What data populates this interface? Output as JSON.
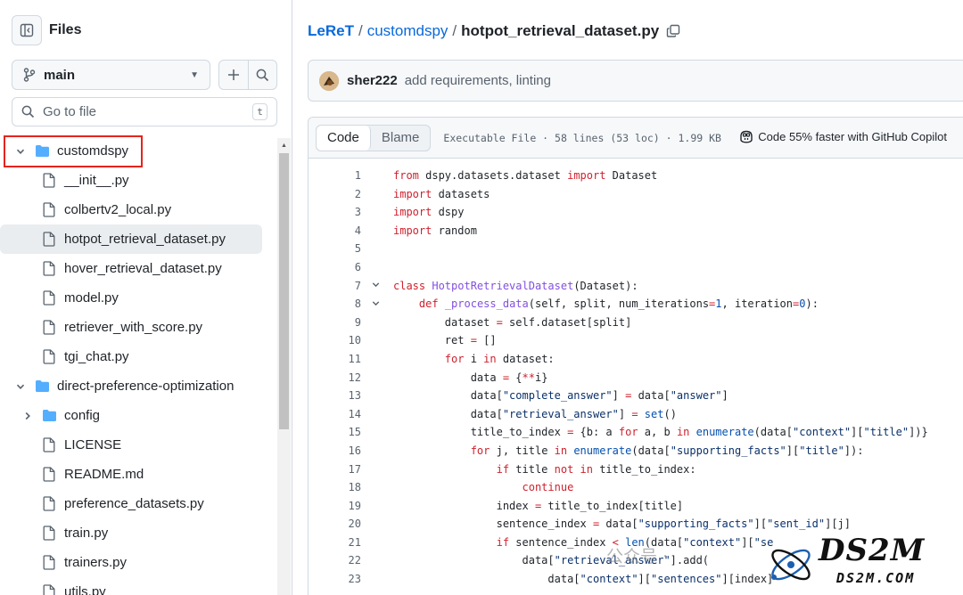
{
  "sidebar": {
    "title": "Files",
    "branch": "main",
    "search_placeholder": "Go to file",
    "search_shortcut": "t",
    "tree": [
      {
        "name": "customdspy",
        "type": "folder",
        "depth": 0,
        "expanded": true,
        "highlighted": true
      },
      {
        "name": "__init__.py",
        "type": "file",
        "depth": 1
      },
      {
        "name": "colbertv2_local.py",
        "type": "file",
        "depth": 1
      },
      {
        "name": "hotpot_retrieval_dataset.py",
        "type": "file",
        "depth": 1,
        "active": true
      },
      {
        "name": "hover_retrieval_dataset.py",
        "type": "file",
        "depth": 1
      },
      {
        "name": "model.py",
        "type": "file",
        "depth": 1
      },
      {
        "name": "retriever_with_score.py",
        "type": "file",
        "depth": 1
      },
      {
        "name": "tgi_chat.py",
        "type": "file",
        "depth": 1
      },
      {
        "name": "direct-preference-optimization",
        "type": "folder",
        "depth": 0,
        "expanded": true
      },
      {
        "name": "config",
        "type": "folder",
        "depth": 1,
        "expanded": false
      },
      {
        "name": "LICENSE",
        "type": "file",
        "depth": 1
      },
      {
        "name": "README.md",
        "type": "file",
        "depth": 1
      },
      {
        "name": "preference_datasets.py",
        "type": "file",
        "depth": 1
      },
      {
        "name": "train.py",
        "type": "file",
        "depth": 1
      },
      {
        "name": "trainers.py",
        "type": "file",
        "depth": 1
      },
      {
        "name": "utils.py",
        "type": "file",
        "depth": 1
      }
    ]
  },
  "breadcrumb": {
    "repo": "LeReT",
    "folder": "customdspy",
    "file": "hotpot_retrieval_dataset.py"
  },
  "commit": {
    "author": "sher222",
    "message": "add requirements, linting"
  },
  "file_header": {
    "tab_code": "Code",
    "tab_blame": "Blame",
    "meta": "Executable File · 58 lines (53 loc) · 1.99 KB",
    "copilot": "Code 55% faster with GitHub Copilot"
  },
  "code_lines": [
    {
      "n": "1",
      "fold": "",
      "html": "<span class=\"k\">from</span> dspy.datasets.dataset <span class=\"k\">import</span> Dataset"
    },
    {
      "n": "2",
      "fold": "",
      "html": "<span class=\"k\">import</span> datasets"
    },
    {
      "n": "3",
      "fold": "",
      "html": "<span class=\"k\">import</span> dspy"
    },
    {
      "n": "4",
      "fold": "",
      "html": "<span class=\"k\">import</span> random"
    },
    {
      "n": "5",
      "fold": "",
      "html": ""
    },
    {
      "n": "6",
      "fold": "",
      "html": ""
    },
    {
      "n": "7",
      "fold": "v",
      "html": "<span class=\"k\">class</span> <span class=\"f\">HotpotRetrievalDataset</span>(Dataset):"
    },
    {
      "n": "8",
      "fold": "v",
      "html": "    <span class=\"k\">def</span> <span class=\"f\">_process_data</span>(self, split, num_iterations<span class=\"k\">=</span><span class=\"n\">1</span>, iteration<span class=\"k\">=</span><span class=\"n\">0</span>):"
    },
    {
      "n": "9",
      "fold": "",
      "html": "        dataset <span class=\"k\">=</span> self.dataset[split]"
    },
    {
      "n": "10",
      "fold": "",
      "html": "        ret <span class=\"k\">=</span> []"
    },
    {
      "n": "11",
      "fold": "",
      "html": "        <span class=\"k\">for</span> i <span class=\"k\">in</span> dataset:"
    },
    {
      "n": "12",
      "fold": "",
      "html": "            data <span class=\"k\">=</span> {<span class=\"k\">**</span>i}"
    },
    {
      "n": "13",
      "fold": "",
      "html": "            data[<span class=\"s\">\"complete_answer\"</span>] <span class=\"k\">=</span> data[<span class=\"s\">\"answer\"</span>]"
    },
    {
      "n": "14",
      "fold": "",
      "html": "            data[<span class=\"s\">\"retrieval_answer\"</span>] <span class=\"k\">=</span> <span class=\"n\">set</span>()"
    },
    {
      "n": "15",
      "fold": "",
      "html": "            title_to_index <span class=\"k\">=</span> {b: a <span class=\"k\">for</span> a, b <span class=\"k\">in</span> <span class=\"n\">enumerate</span>(data[<span class=\"s\">\"context\"</span>][<span class=\"s\">\"title\"</span>])}"
    },
    {
      "n": "16",
      "fold": "",
      "html": "            <span class=\"k\">for</span> j, title <span class=\"k\">in</span> <span class=\"n\">enumerate</span>(data[<span class=\"s\">\"supporting_facts\"</span>][<span class=\"s\">\"title\"</span>]):"
    },
    {
      "n": "17",
      "fold": "",
      "html": "                <span class=\"k\">if</span> title <span class=\"k\">not in</span> title_to_index:"
    },
    {
      "n": "18",
      "fold": "",
      "html": "                    <span class=\"k\">continue</span>"
    },
    {
      "n": "19",
      "fold": "",
      "html": "                index <span class=\"k\">=</span> title_to_index[title]"
    },
    {
      "n": "20",
      "fold": "",
      "html": "                sentence_index <span class=\"k\">=</span> data[<span class=\"s\">\"supporting_facts\"</span>][<span class=\"s\">\"sent_id\"</span>][j]"
    },
    {
      "n": "21",
      "fold": "",
      "html": "                <span class=\"k\">if</span> sentence_index <span class=\"k\">&lt;</span> <span class=\"n\">len</span>(data[<span class=\"s\">\"context\"</span>][<span class=\"s\">\"se</span>"
    },
    {
      "n": "22",
      "fold": "",
      "html": "                    data[<span class=\"s\">\"retrieval_answer\"</span>].add("
    },
    {
      "n": "23",
      "fold": "",
      "html": "                        data[<span class=\"s\">\"context\"</span>][<span class=\"s\">\"sentences\"</span>][index]"
    }
  ],
  "watermark": {
    "cn": "公众号 ·",
    "logo": "DS2M",
    "sub": "DS2M.COM"
  }
}
